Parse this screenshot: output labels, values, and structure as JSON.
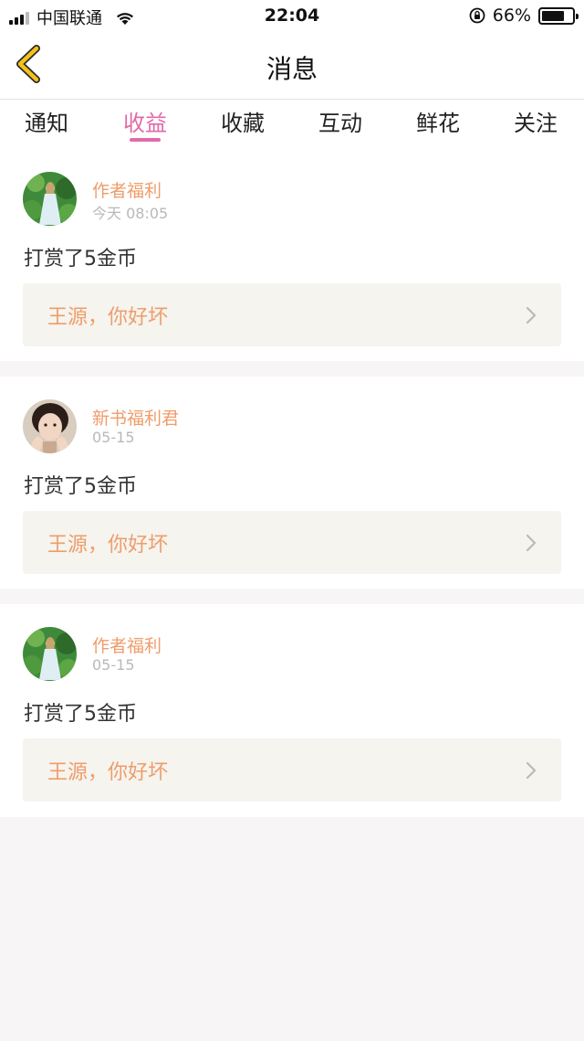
{
  "status_bar": {
    "carrier": "中国联通",
    "time": "22:04",
    "battery": "66%",
    "battery_level": 0.66
  },
  "nav": {
    "title": "消息",
    "back_icon": "chevron-left-icon"
  },
  "tabs": [
    {
      "label": "通知",
      "active": false
    },
    {
      "label": "收益",
      "active": true
    },
    {
      "label": "收藏",
      "active": false
    },
    {
      "label": "互动",
      "active": false
    },
    {
      "label": "鲜花",
      "active": false
    },
    {
      "label": "关注",
      "active": false
    }
  ],
  "items": [
    {
      "author": "作者福利",
      "time": "今天 08:05",
      "text": "打赏了5金币",
      "reply": "王源，你好坏"
    },
    {
      "author": "新书福利君",
      "time": "05-15",
      "text": "打赏了5金币",
      "reply": "王源，你好坏"
    },
    {
      "author": "作者福利",
      "time": "05-15",
      "text": "打赏了5金币",
      "reply": "王源，你好坏"
    }
  ],
  "colors": {
    "accent": "#e26aa7",
    "author": "#ef9d6b",
    "back_icon": "#f2c21b",
    "reply_bg": "#f5f4ee",
    "page_bg": "#f7f5f5"
  }
}
